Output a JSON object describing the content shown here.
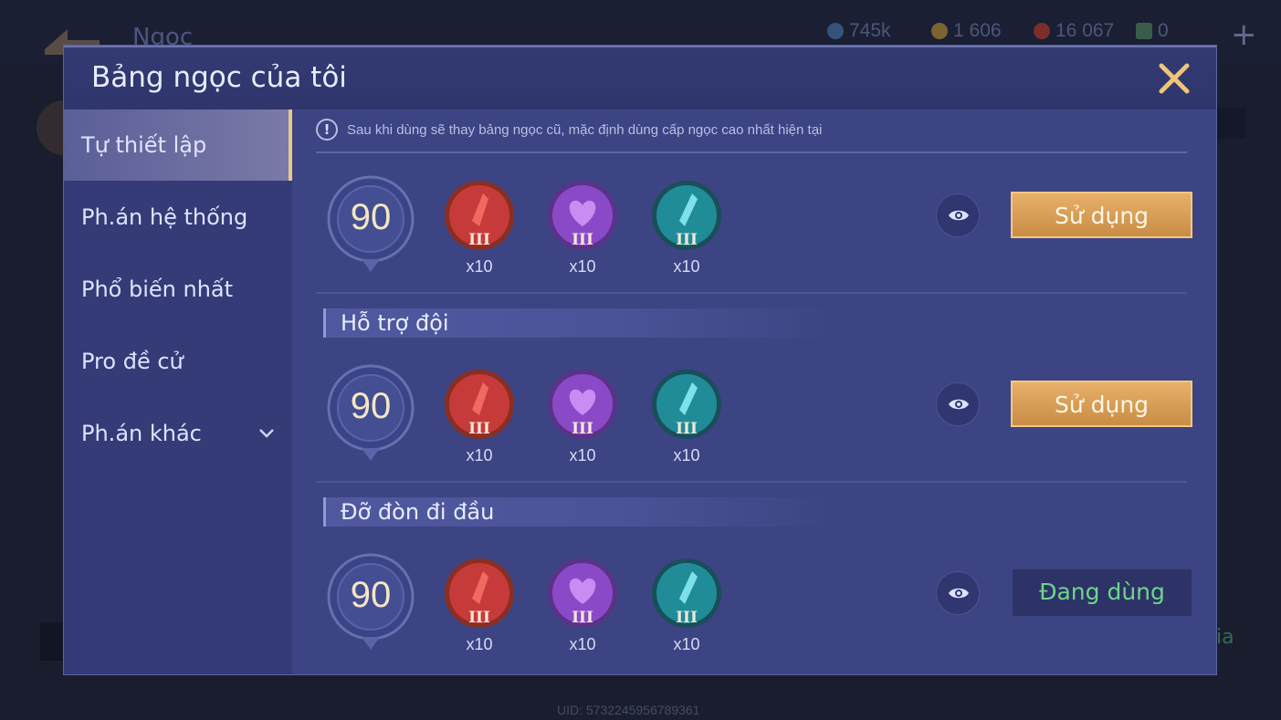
{
  "background": {
    "screen_title": "Ngọc",
    "resources": [
      {
        "icon": "blue-gem-icon",
        "value": "745k"
      },
      {
        "icon": "gold-coin-icon",
        "value": "1 606"
      },
      {
        "icon": "red-crystal-icon",
        "value": "16 067"
      },
      {
        "icon": "card-icon",
        "value": "0"
      }
    ],
    "right_text": "ia",
    "uid": "UID: 5732245956789361"
  },
  "modal": {
    "title": "Bảng ngọc của tôi",
    "close_icon": "close-icon"
  },
  "sidebar": {
    "items": [
      {
        "label": "Tự thiết lập",
        "active": true
      },
      {
        "label": "Ph.án hệ thống",
        "active": false
      },
      {
        "label": "Phổ biến nhất",
        "active": false
      },
      {
        "label": "Pro đề cử",
        "active": false
      },
      {
        "label": "Ph.án khác",
        "active": false,
        "has_dropdown": true
      }
    ]
  },
  "notice": "Sau khi dùng sẽ thay bảng ngọc cũ, mặc định dùng cấp ngọc cao nhất hiện tại",
  "pages": [
    {
      "section_title": "",
      "level": "90",
      "gems": [
        {
          "color": "red",
          "tier": "III",
          "count": "x10"
        },
        {
          "color": "purple",
          "tier": "III",
          "count": "x10"
        },
        {
          "color": "cyan",
          "tier": "III",
          "count": "x10"
        }
      ],
      "action": "Sử dụng",
      "in_use": false
    },
    {
      "section_title": "Hỗ trợ đội",
      "level": "90",
      "gems": [
        {
          "color": "red",
          "tier": "III",
          "count": "x10"
        },
        {
          "color": "purple",
          "tier": "III",
          "count": "x10"
        },
        {
          "color": "cyan",
          "tier": "III",
          "count": "x10"
        }
      ],
      "action": "Sử dụng",
      "in_use": false
    },
    {
      "section_title": "Đỡ đòn đi đầu",
      "level": "90",
      "gems": [
        {
          "color": "red",
          "tier": "III",
          "count": "x10"
        },
        {
          "color": "purple",
          "tier": "III",
          "count": "x10"
        },
        {
          "color": "cyan",
          "tier": "III",
          "count": "x10"
        }
      ],
      "action": "Đang dùng",
      "in_use": true
    }
  ],
  "colors": {
    "gem_red": "#c73a3a",
    "gem_purple": "#8a4ac8",
    "gem_cyan": "#1f8c98",
    "button_gold": "#d9a05a",
    "in_use_green": "#6fd48e"
  }
}
